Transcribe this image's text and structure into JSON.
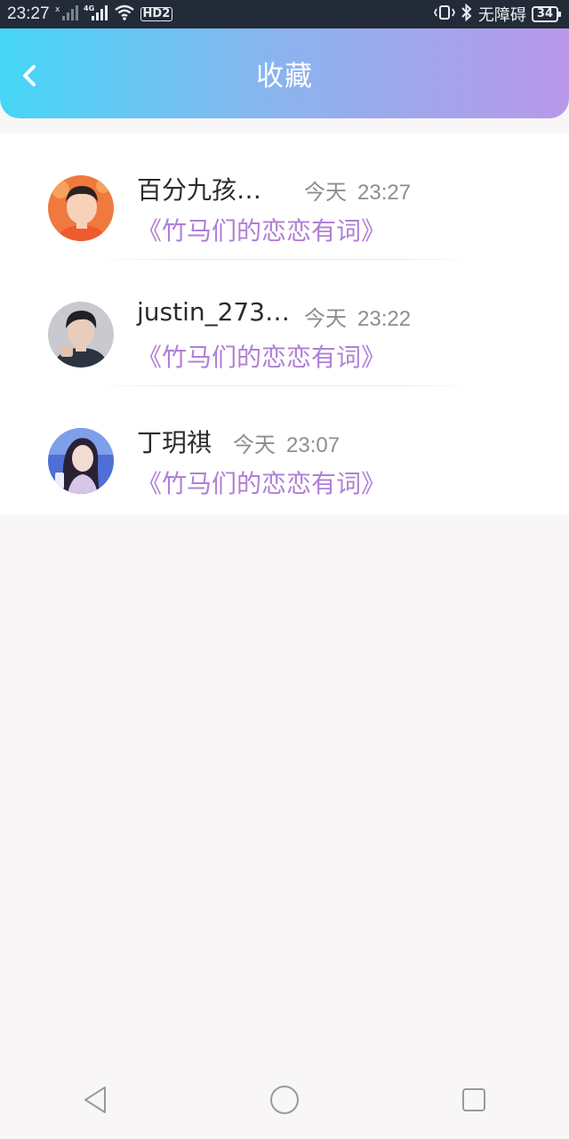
{
  "status_bar": {
    "time": "23:27",
    "sim1_label": "x",
    "network_label": "4G",
    "hd_label": "HD2",
    "accessibility_text": "无障碍",
    "battery_level": "34"
  },
  "header": {
    "title": "收藏"
  },
  "favorites": [
    {
      "name": "百分九孩…",
      "day": "今天",
      "time": "23:27",
      "work_title": "《竹马们的恋恋有词》"
    },
    {
      "name": "justin_273…",
      "day": "今天",
      "time": "23:22",
      "work_title": "《竹马们的恋恋有词》"
    },
    {
      "name": "丁玥祺",
      "day": "今天",
      "time": "23:07",
      "work_title": "《竹马们的恋恋有词》"
    }
  ],
  "colors": {
    "header_gradient_start": "#45d6f6",
    "header_gradient_end": "#b898ea",
    "work_title": "#b07fd6",
    "time_text": "#8e8e8e"
  },
  "icons": {
    "back": "chevron-left-icon",
    "nav_back": "triangle-back-icon",
    "nav_home": "circle-home-icon",
    "nav_recents": "square-recents-icon"
  }
}
